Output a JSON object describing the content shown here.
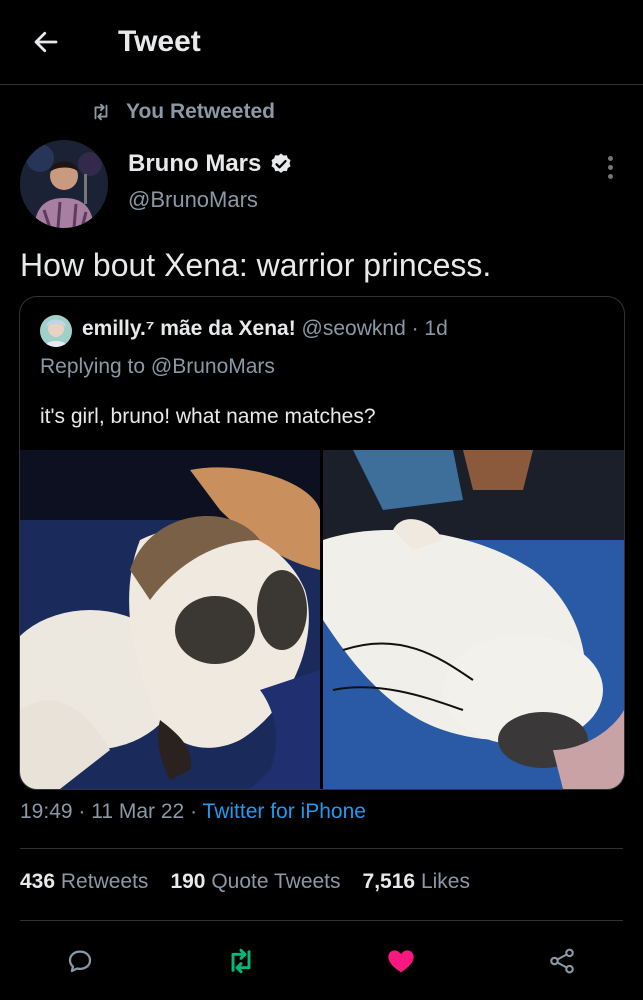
{
  "header": {
    "title": "Tweet"
  },
  "social_context": {
    "label": "You Retweeted"
  },
  "author": {
    "name": "Bruno Mars",
    "handle": "@BrunoMars"
  },
  "tweet": {
    "text": "How bout Xena: warrior princess."
  },
  "quoted": {
    "name": "emilly.⁷ mãe da Xena!",
    "handle": "@seowknd",
    "age": "1d",
    "replying_to": "Replying to @BrunoMars",
    "text": "it's girl, bruno! what name matches?"
  },
  "meta": {
    "time": "19:49",
    "date": "11 Mar 22",
    "source": "Twitter for iPhone"
  },
  "stats": {
    "retweets_count": "436",
    "retweets_label": "Retweets",
    "quotes_count": "190",
    "quotes_label": "Quote Tweets",
    "likes_count": "7,516",
    "likes_label": "Likes"
  },
  "colors": {
    "accent": "#1d9bf0",
    "retweet": "#00ba7c",
    "like": "#f91880",
    "secondary_text": "#8b98a5"
  },
  "icons": [
    "back-arrow-icon",
    "retweet-icon",
    "verified-badge-icon",
    "more-icon",
    "reply-icon",
    "like-icon",
    "share-icon"
  ]
}
